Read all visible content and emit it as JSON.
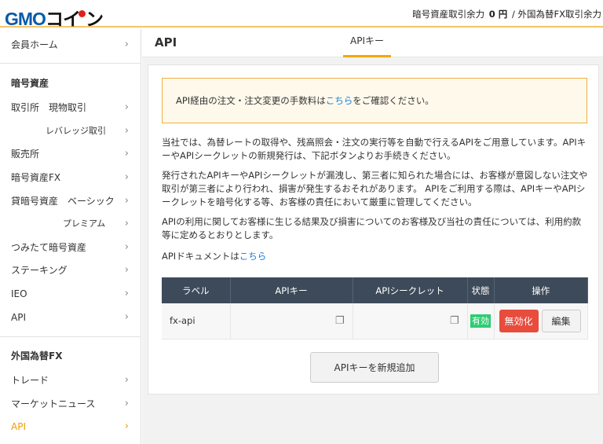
{
  "header": {
    "logo": "GMOコイン",
    "balance_label": "暗号資産取引余力",
    "balance_value": "0 円",
    "separator": "/",
    "fx_label": "外国為替FX取引余力"
  },
  "sidebar": {
    "items": [
      {
        "label": "会員ホーム",
        "type": "item"
      },
      {
        "label": "暗号資産",
        "type": "section"
      },
      {
        "label": "取引所　現物取引",
        "type": "item"
      },
      {
        "label": "レバレッジ取引",
        "type": "sub"
      },
      {
        "label": "販売所",
        "type": "item"
      },
      {
        "label": "暗号資産FX",
        "type": "item"
      },
      {
        "label": "貸暗号資産　ベーシック",
        "type": "item"
      },
      {
        "label": "プレミアム",
        "type": "sub"
      },
      {
        "label": "つみたて暗号資産",
        "type": "item"
      },
      {
        "label": "ステーキング",
        "type": "item"
      },
      {
        "label": "IEO",
        "type": "item"
      },
      {
        "label": "API",
        "type": "item"
      },
      {
        "label": "外国為替FX",
        "type": "section"
      },
      {
        "label": "トレード",
        "type": "item"
      },
      {
        "label": "マーケットニュース",
        "type": "item"
      },
      {
        "label": "API",
        "type": "active"
      }
    ]
  },
  "main": {
    "title": "API",
    "tab": "APIキー",
    "notice": {
      "pre": "API経由の注文・注文変更の手数料は",
      "link": "こちら",
      "post": "をご確認ください。"
    },
    "p1": "当社では、為替レートの取得や、残高照会・注文の実行等を自動で行えるAPIをご用意しています。APIキーやAPIシークレットの新規発行は、下記ボタンよりお手続きください。",
    "p2": "発行されたAPIキーやAPIシークレットが漏洩し、第三者に知られた場合には、お客様が意図しない注文や取引が第三者により行われ、損害が発生するおそれがあります。 APIをご利用する際は、APIキーやAPIシークレットを暗号化する等、お客様の責任において厳重に管理してください。",
    "p3": "APIの利用に関してお客様に生じる結果及び損害についてのお客様及び当社の責任については、利用約款等に定めるとおりとします。",
    "doc": {
      "pre": "APIドキュメントは",
      "link": "こちら"
    },
    "table": {
      "headers": [
        "ラベル",
        "APIキー",
        "APIシークレット",
        "状態",
        "操作"
      ],
      "rows": [
        {
          "label": "fx-api",
          "status": "有効",
          "disable": "無効化",
          "edit": "編集"
        }
      ]
    },
    "add_button": "APIキーを新規追加"
  },
  "colors": {
    "accent": "#f5a800",
    "header_bg": "#3d4a5a",
    "danger": "#e74c3c",
    "success": "#2ecc71"
  }
}
